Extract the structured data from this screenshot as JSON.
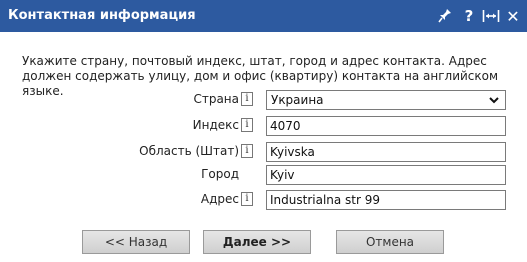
{
  "window": {
    "title": "Контактная информация",
    "icons": [
      "pin-icon",
      "help-icon",
      "resize-icon",
      "close-icon"
    ],
    "icon_glyphs": {
      "help": "?",
      "close": "✕"
    }
  },
  "instructions": "Укажите страну, почтовый индекс, штат, город и адрес контакта. Адрес должен содержать улицу, дом и офис (квартиру) контакта на английском языке.",
  "info_glyph": "i",
  "form": {
    "country": {
      "label": "Страна",
      "value": "Украина"
    },
    "postal_code": {
      "label": "Индекс",
      "value": "4070"
    },
    "region": {
      "label": "Область (Штат)",
      "value": "Kyivska"
    },
    "city": {
      "label": "Город",
      "value": "Kyiv"
    },
    "address": {
      "label": "Адрес",
      "value": "Industrialna str 99"
    }
  },
  "buttons": {
    "back": "<< Назад",
    "next": "Далее >>",
    "cancel": "Отмена"
  },
  "colors": {
    "titlebar": "#2d5aa0",
    "button_face": "#dcdcdc"
  }
}
